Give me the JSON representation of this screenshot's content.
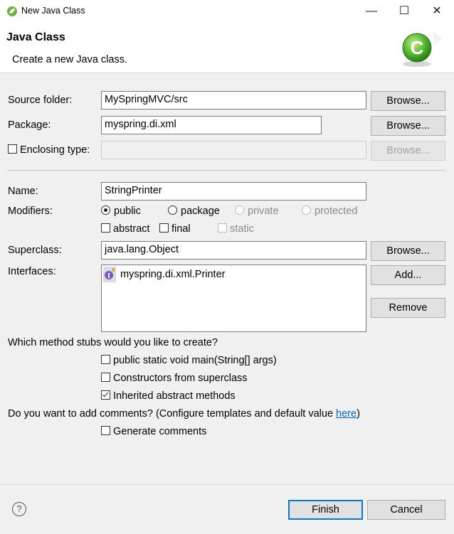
{
  "window": {
    "title": "New Java Class",
    "minimize": "—",
    "maximize": "☐",
    "close": "✕"
  },
  "header": {
    "title": "Java Class",
    "description": "Create a new Java class."
  },
  "form": {
    "source_folder": {
      "label": "Source folder:",
      "value": "MySpringMVC/src",
      "browse": "Browse..."
    },
    "package": {
      "label": "Package:",
      "value": "myspring.di.xml",
      "browse": "Browse..."
    },
    "enclosing": {
      "label": "Enclosing type:",
      "value": "",
      "browse": "Browse...",
      "checked": false
    },
    "name": {
      "label": "Name:",
      "value": "StringPrinter"
    },
    "modifiers": {
      "label": "Modifiers:",
      "public": "public",
      "package": "package",
      "private": "private",
      "protected": "protected",
      "abstract": "abstract",
      "final": "final",
      "static": "static",
      "selected": "public"
    },
    "superclass": {
      "label": "Superclass:",
      "value": "java.lang.Object",
      "browse": "Browse..."
    },
    "interfaces": {
      "label": "Interfaces:",
      "items": [
        "myspring.di.xml.Printer"
      ],
      "add": "Add...",
      "remove": "Remove"
    }
  },
  "stubs": {
    "question": "Which method stubs would you like to create?",
    "main": {
      "label": "public static void main(String[] args)",
      "checked": false
    },
    "constructors": {
      "label": "Constructors from superclass",
      "checked": false
    },
    "inherited": {
      "label": "Inherited abstract methods",
      "checked": true
    }
  },
  "comments": {
    "question": "Do you want to add comments? (Configure templates and default value ",
    "link": "here",
    "question_end": ")",
    "generate": {
      "label": "Generate comments",
      "checked": false
    }
  },
  "footer": {
    "help": "?",
    "finish": "Finish",
    "cancel": "Cancel"
  },
  "colors": {
    "accent": "#0078d7",
    "link": "#0066cc",
    "spring_green": "#6db33f"
  },
  "icons": {
    "app": "spring-leaf-icon",
    "wizard": "java-class-wizard-icon",
    "interface": "interface-icon",
    "help": "help-icon"
  }
}
